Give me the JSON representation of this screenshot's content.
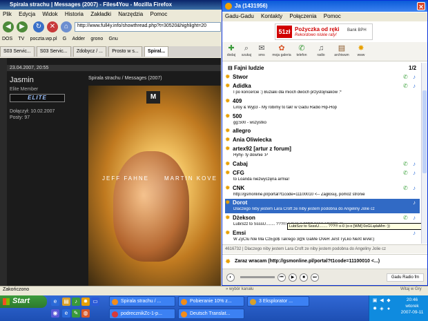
{
  "firefox": {
    "title": "Spirala strachu | Messages (2007) - Files4You - Mozilla Firefox",
    "menu": [
      "Plik",
      "Edycja",
      "Widok",
      "Historia",
      "Zakładki",
      "Narzędzia",
      "Pomoc"
    ],
    "url": "http://www.full4y.info/showthread.php?t=30520&highlight=20",
    "bookmarks": [
      "DOS",
      "TV",
      "poczta.wp.pl",
      "G",
      "Adder",
      "grono",
      "Gnu"
    ],
    "tabs": [
      "S03 Servic...",
      "S03 Servic...",
      "Zdobycz / ...",
      "Prosto w s...",
      "Spiral..."
    ],
    "status": "Zakończono"
  },
  "post": {
    "date": "23.04.2007, 20:55",
    "username": "Jasmin",
    "rank": "Elite Member",
    "badge": "ELITE",
    "joined": "Dołączył: 10.02.2007",
    "posts": "Posty: 97",
    "title": "Spirala strachu / Messages (2007)",
    "poster_logo": "M",
    "actor1": "JEFF FAHNE",
    "actor2": "MARTIN KOVE"
  },
  "gg": {
    "title": "Ja (1431956)",
    "menu": [
      "Gadu-Gadu",
      "Kontakty",
      "Połączenia",
      "Pomoc"
    ],
    "ad": {
      "price": "51zł",
      "line1": "Pożyczka od ręki",
      "line2": "Rekordowo niskie raty!",
      "bank": "Bank BPH"
    },
    "toolbar": [
      "dodaj",
      "szukaj",
      "sms",
      "moja galeria",
      "telefon",
      "radio",
      "archiwum",
      "www"
    ],
    "group": "Fajni ludzie",
    "page": "1/2",
    "contacts": [
      {
        "name": "Stwor",
        "desc": ""
      },
      {
        "name": "Adidka",
        "desc": "I po koncercie :) Buziaki dla mioch dwóch przystojniaków :*"
      },
      {
        "name": "409",
        "desc": "Liroy & Wyp3 - My robimy to tak! w Gadu Radio Hip-Hop"
      },
      {
        "name": "500",
        "desc": "gg:500 - wszystko"
      },
      {
        "name": "allegro",
        "desc": ""
      },
      {
        "name": "Ania Oliwiecka",
        "desc": ""
      },
      {
        "name": "artex92 [artur z forum]",
        "desc": "Hyhy- ty downie :P"
      },
      {
        "name": "Cabaj",
        "desc": ""
      },
      {
        "name": "CFG",
        "desc": "to Loanda niezwyczęna armia!"
      },
      {
        "name": "CNK",
        "desc": "http://gsmonline.pl/portal?t1code=11100010 <-- Zagłosuj, pomóż stronie"
      },
      {
        "name": "Dorot",
        "desc": "Dlaczego niby jestem Lara Croft ze niby jestem podobna do Angeliny Jolie cz"
      },
      {
        "name": "Dżekson",
        "desc": "LubiSzz to SsssU........ ???!!! o-0 (o-o [WM] 0oGLądaMm :))"
      },
      {
        "name": "Emsi",
        "desc": "W ŻyCIu NIe Ma CzEgo$ Tak!ego 3@k GaMe OVeR JeSt TyLko NeXt leVel:)"
      }
    ],
    "tooltip": "LubiSzz to SsssU........ ???!!! o-0 (o-o [WM] 0oGLądaMm :))",
    "desc_bar": "4616732 | Dlaczego niby jestem Lara Croft ze niby jestem podobna do Angeliny Jolie cz",
    "status": "Zaraz wracam (http://gsmonline.pl/portal?t1code=11100010 <...)",
    "radio_select": "» wybór kanału",
    "radio_brand": "Gadu Radio fm",
    "footer_note": "Witaj w Gry"
  },
  "taskbar": {
    "start": "Start",
    "tasks_row1": [
      "Spirala strachu / ...",
      "Pobieranie 10% z...",
      "3 Eksplorator ..."
    ],
    "tasks_row2": [
      "podrecznikZc-1-p...",
      "Deutsch Translat..."
    ],
    "clock_time": "20:46",
    "clock_day": "wtorek",
    "clock_date": "2007-09-11"
  },
  "colors": {
    "xp_blue": "#0a246a",
    "gg_title": "#0a5bd8",
    "selected": "#316ac5",
    "gg_star": "#e8a000"
  }
}
